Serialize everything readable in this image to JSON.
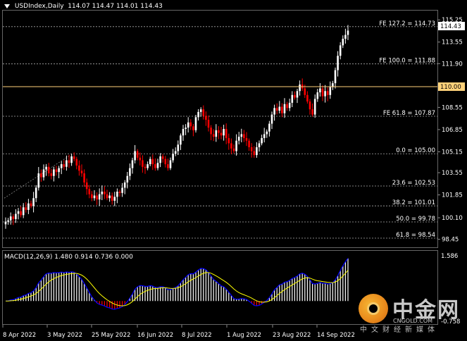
{
  "header": {
    "symbol": "USDIndex,Daily",
    "ohlc": "114.07 114.47 114.01 114.43"
  },
  "macd": {
    "label": "MACD(12,26,9) 1.480 0.914 0.736 0.000",
    "axis_top": "1.586",
    "axis_bottom": "-0.758"
  },
  "price_axis": [
    "115.25",
    "113.55",
    "111.90",
    "110.25",
    "108.55",
    "106.85",
    "105.15",
    "103.55",
    "101.85",
    "100.10",
    "98.45"
  ],
  "current_price": "114.43",
  "level_110": "110.00",
  "fib_levels": [
    {
      "label": "FE 127.2 = 114.73",
      "value": 114.73
    },
    {
      "label": "FE 100.0 = 111.88",
      "value": 111.88
    },
    {
      "label": "FE 61.8 = 107.87",
      "value": 107.87
    },
    {
      "label": "0.0 = 105.00",
      "value": 105.0
    },
    {
      "label": "23.6 = 102.53",
      "value": 102.53
    },
    {
      "label": "38.2 = 101.01",
      "value": 101.01
    },
    {
      "label": "50.0 = 99.78",
      "value": 99.78
    },
    {
      "label": "61.8 = 98.54",
      "value": 98.54
    }
  ],
  "date_axis": [
    "8 Apr 2022",
    "3 May 2022",
    "25 May 2022",
    "16 Jun 2022",
    "8 Jul 2022",
    "1 Aug 2022",
    "23 Aug 2022",
    "14 Sep 2022"
  ],
  "colors": {
    "bull": "#ffffff",
    "bear": "#ff0000",
    "macd_line": "#0000ff",
    "signal_line": "#ffff00",
    "level": "#ffd27a"
  },
  "watermark": {
    "brand": "中金网",
    "url": "CNGOLD.COM",
    "tagline": "中文财经新媒体"
  },
  "chart_data": {
    "type": "candlestick",
    "ylim": [
      98.0,
      115.8
    ],
    "close": [
      99.8,
      99.9,
      100.2,
      100.0,
      100.4,
      100.6,
      100.3,
      100.9,
      100.7,
      101.2,
      101.0,
      101.6,
      102.4,
      103.5,
      103.2,
      103.8,
      104.0,
      103.5,
      103.3,
      103.8,
      103.6,
      103.9,
      104.2,
      104.0,
      104.5,
      104.3,
      104.8,
      104.6,
      104.1,
      103.7,
      103.5,
      102.8,
      102.3,
      101.9,
      101.6,
      101.8,
      101.5,
      101.9,
      102.1,
      101.9,
      101.6,
      101.8,
      101.4,
      101.7,
      102.1,
      102.0,
      102.4,
      102.8,
      103.3,
      103.9,
      104.5,
      105.2,
      104.7,
      104.5,
      104.0,
      103.9,
      104.2,
      104.6,
      104.2,
      103.9,
      104.3,
      104.8,
      104.6,
      104.2,
      103.9,
      104.5,
      105.0,
      105.2,
      105.7,
      106.4,
      106.9,
      107.0,
      107.4,
      107.1,
      106.8,
      107.8,
      108.2,
      108.4,
      107.9,
      107.6,
      107.0,
      106.5,
      106.3,
      106.8,
      106.6,
      106.4,
      106.9,
      106.2,
      105.8,
      105.4,
      105.2,
      106.0,
      106.3,
      106.5,
      106.2,
      106.0,
      105.5,
      105.2,
      104.9,
      105.5,
      105.8,
      106.2,
      106.5,
      106.7,
      107.3,
      108.0,
      108.5,
      108.3,
      108.6,
      108.1,
      108.8,
      108.5,
      108.9,
      109.5,
      109.3,
      109.8,
      110.3,
      110.0,
      109.5,
      109.0,
      108.4,
      108.0,
      109.2,
      109.7,
      110.0,
      109.4,
      109.8,
      109.5,
      110.1,
      110.4,
      111.4,
      112.5,
      113.3,
      113.8,
      114.1,
      114.43
    ]
  }
}
